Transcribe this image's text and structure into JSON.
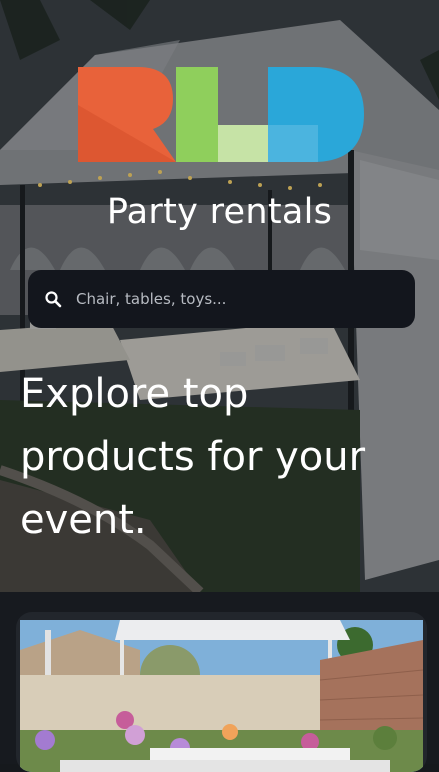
{
  "brand": {
    "logo_text": "RLD",
    "title": "Party rentals",
    "logo_colors": [
      "#e8623a",
      "#8fcf5c",
      "#2aa7d9"
    ]
  },
  "search": {
    "icon": "search-icon",
    "placeholder": "Chair, tables, toys...",
    "value": ""
  },
  "hero": {
    "headline": "Explore top products for your event.",
    "background": "evening party tent with tables and chairs"
  },
  "products": [
    {
      "image": "outdoor tent setup with flowers and table decorations"
    }
  ],
  "colors": {
    "page_bg": "#16191d",
    "search_bg": "#13161d",
    "card_bg": "#22262c",
    "text": "#ffffff"
  }
}
